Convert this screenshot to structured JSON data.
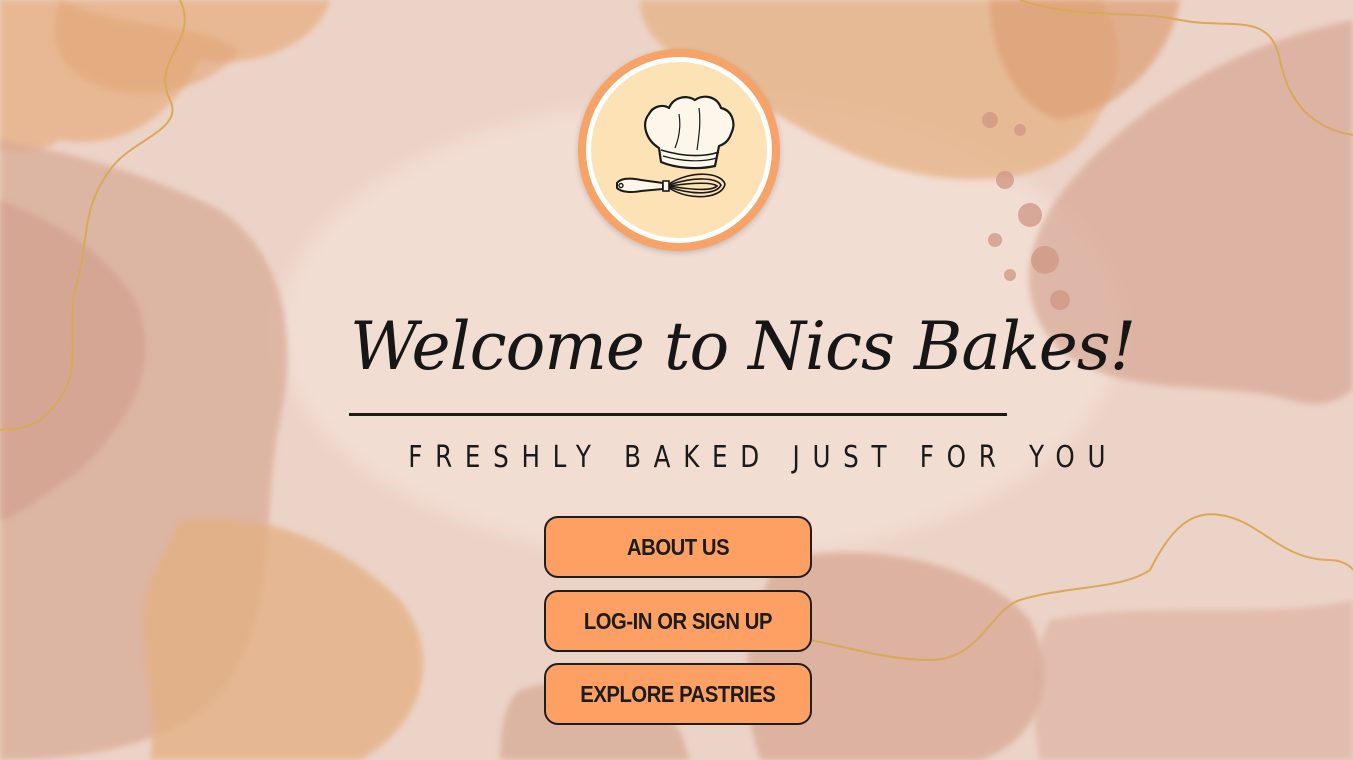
{
  "hero": {
    "title": "Welcome to Nics Bakes!",
    "tagline": "FRESHLY BAKED JUST FOR YOU"
  },
  "logo": {
    "icon": "chef-hat-whisk-icon"
  },
  "buttons": [
    {
      "label": "ABOUT US"
    },
    {
      "label": "LOG-IN OR SIGN UP"
    },
    {
      "label": "EXPLORE PASTRIES"
    }
  ],
  "colors": {
    "background": "#ecd2c6",
    "button": "#fea064",
    "logo_ring": "#f7a266",
    "logo_fill": "#fde2b6",
    "gold_line": "#d9a95a"
  }
}
